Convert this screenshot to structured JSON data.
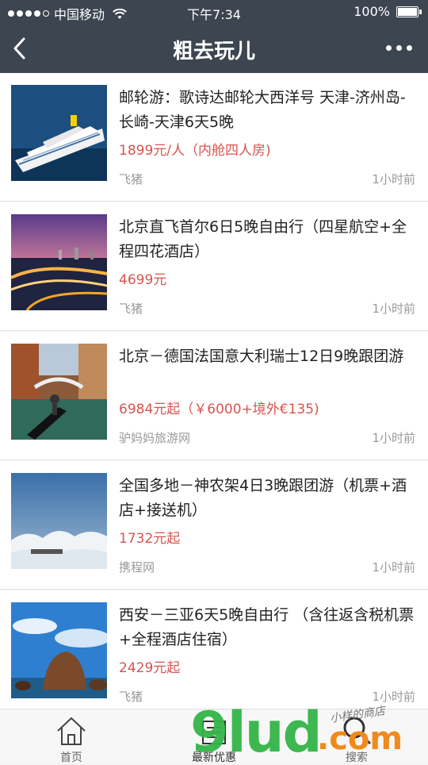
{
  "status": {
    "carrier": "中国移动",
    "time": "下午7:34",
    "battery": "100%"
  },
  "nav": {
    "title": "粗去玩儿",
    "back_icon": "chevron-left-icon",
    "more_icon": "more-dots-icon"
  },
  "items": [
    {
      "title": "邮轮游：歌诗达邮轮大西洋号 天津-济州岛-长崎-天津6天5晚",
      "price": "1899元/人（内舱四人房)",
      "source": "飞猪",
      "time": "1小时前",
      "image": "cruise-ship"
    },
    {
      "title": "北京直飞首尔6日5晚自由行（四星航空+全程四花酒店）",
      "price": "4699元",
      "source": "飞猪",
      "time": "1小时前",
      "image": "city-bridge-night"
    },
    {
      "title": "北京－德国法国意大利瑞士12日9晚跟团游",
      "price": "6984元起（￥6000+境外€135)",
      "source": "驴妈妈旅游网",
      "time": "1小时前",
      "image": "venice-canal"
    },
    {
      "title": "全国多地－神农架4日3晚跟团游（机票+酒店+接送机）",
      "price": "1732元起",
      "source": "携程网",
      "time": "1小时前",
      "image": "sea-of-clouds"
    },
    {
      "title": "西安－三亚6天5晚自由行 （含往返含税机票+全程酒店住宿）",
      "price": "2429元起",
      "source": "飞猪",
      "time": "1小时前",
      "image": "beach-rocks"
    }
  ],
  "tabs": [
    {
      "label": "首页",
      "icon": "home-icon"
    },
    {
      "label": "最新优惠",
      "icon": "news-icon"
    },
    {
      "label": "搜索",
      "icon": "search-icon"
    }
  ],
  "watermark": {
    "logo": "9lud",
    "suffix": ".com",
    "script": "小样的商店"
  },
  "colors": {
    "nav_bg": "#3d4551",
    "price": "#d9534f",
    "watermark_green": "#34b548",
    "watermark_orange": "#f08a1c"
  }
}
